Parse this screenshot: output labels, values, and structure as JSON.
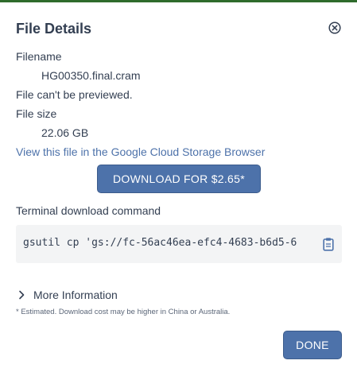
{
  "dialog": {
    "title": "File Details",
    "close_icon": "close-circle-icon"
  },
  "file": {
    "filename_label": "Filename",
    "filename": "HG00350.final.cram",
    "preview_note": "File can't be previewed.",
    "size_label": "File size",
    "size": "22.06 GB"
  },
  "gcs_link": "View this file in the Google Cloud Storage Browser",
  "download_button": "DOWNLOAD FOR $2.65*",
  "terminal": {
    "label": "Terminal download command",
    "command": "gsutil cp 'gs://fc-56ac46ea-efc4-4683-b6d5-6",
    "copy_icon": "clipboard-icon"
  },
  "more_info": {
    "label": "More Information",
    "icon": "chevron-right-icon",
    "expanded": false
  },
  "footnote": "* Estimated. Download cost may be higher in China or Australia.",
  "done_button": "DONE",
  "colors": {
    "primary": "#4d72aa",
    "text": "#333f52",
    "header_bar": "#2f6b2c",
    "code_bg": "#f3f4f5"
  }
}
